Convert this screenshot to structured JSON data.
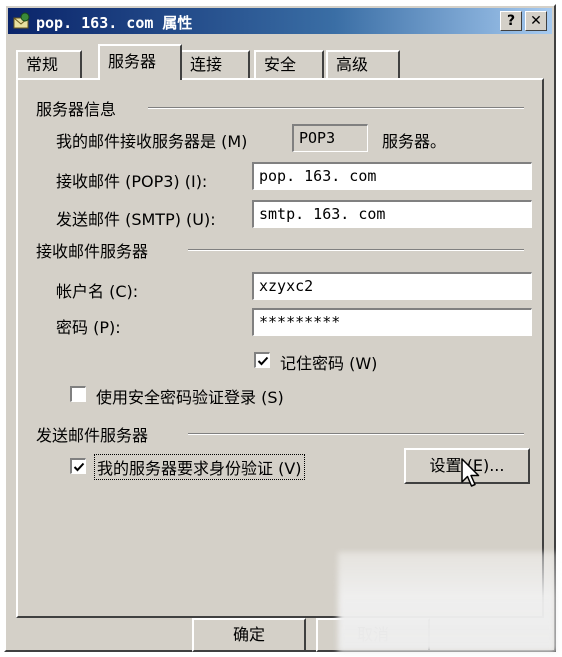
{
  "window": {
    "title": "pop. 163. com 属性",
    "help_label": "?",
    "close_label": "✕"
  },
  "tabs": [
    {
      "label": "常规",
      "active": false
    },
    {
      "label": "服务器",
      "active": true
    },
    {
      "label": "连接",
      "active": false
    },
    {
      "label": "安全",
      "active": false
    },
    {
      "label": "高级",
      "active": false
    }
  ],
  "server_info": {
    "group_title": "服务器信息",
    "incoming_type_label": "我的邮件接收服务器是 (M)",
    "incoming_type_value": "POP3",
    "incoming_type_suffix": "服务器。",
    "incoming_label": "接收邮件 (POP3) (I):",
    "incoming_value": "pop. 163. com",
    "outgoing_label": "发送邮件 (SMTP) (U):",
    "outgoing_value": "smtp. 163. com"
  },
  "incoming_server": {
    "group_title": "接收邮件服务器",
    "account_label": "帐户名 (C):",
    "account_value": "xzyxc2",
    "password_label": "密码 (P):",
    "password_value": "*********",
    "remember_label": "记住密码 (W)",
    "remember_checked": true,
    "spa_label": "使用安全密码验证登录 (S)",
    "spa_checked": false
  },
  "outgoing_server": {
    "group_title": "发送邮件服务器",
    "auth_label": "我的服务器要求身份验证 (V)",
    "auth_checked": true,
    "settings_label": "设置 (E)..."
  },
  "footer": {
    "ok_label": "确定",
    "cancel_label": "取消"
  },
  "colors": {
    "dialog_face": "#d4d0c8",
    "titlebar_start": "#0a246a",
    "titlebar_end": "#a6caf0"
  }
}
